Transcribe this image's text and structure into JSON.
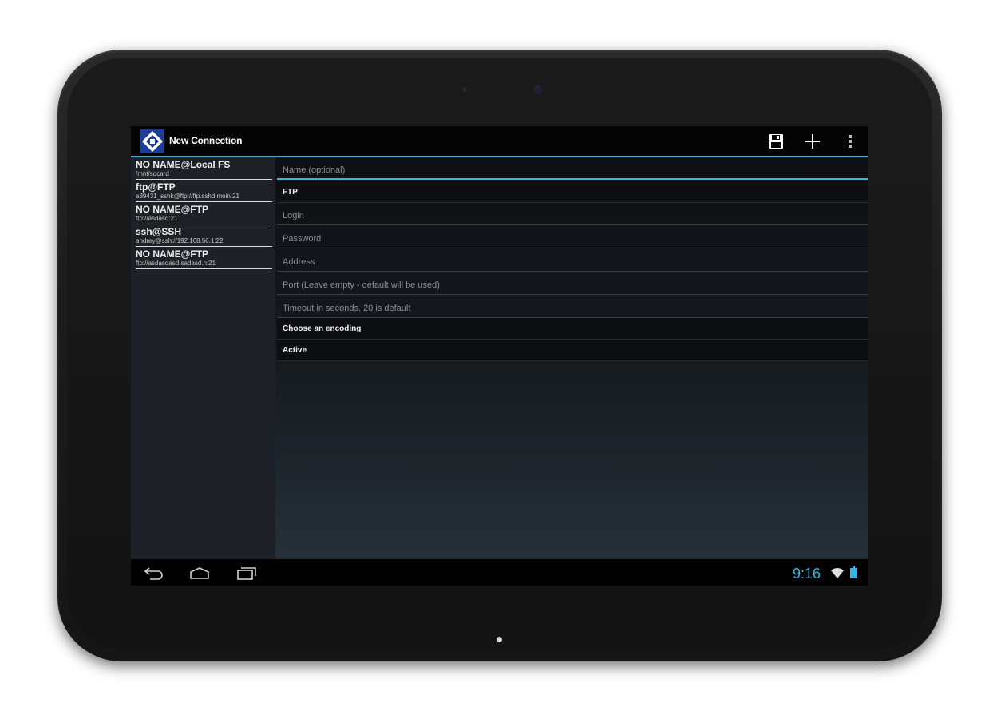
{
  "app": {
    "title": "New Connection",
    "accent_color": "#33b5e5",
    "logo_icon": "app-logo-diamond-icon"
  },
  "toolbar": {
    "save_icon": "save-disk-icon",
    "add_icon": "plus-icon",
    "overflow_icon": "overflow-menu-icon"
  },
  "connections": [
    {
      "name": "NO NAME@Local FS",
      "path": "/mnt/sdcard"
    },
    {
      "name": "ftp@FTP",
      "path": "a39431_sshk@ftp://ftp.sshd.moin:21"
    },
    {
      "name": "NO NAME@FTP",
      "path": "ftp://asdasd:21"
    },
    {
      "name": "ssh@SSH",
      "path": "andrey@ssh://192.168.56.1:22"
    },
    {
      "name": "NO NAME@FTP",
      "path": "ftp://asdasdasd.sadasd.n:21"
    }
  ],
  "form": {
    "name_placeholder": "Name (optional)",
    "protocol_value": "FTP",
    "login_placeholder": "Login",
    "password_placeholder": "Password",
    "address_placeholder": "Address",
    "port_placeholder": "Port (Leave empty - default will be used)",
    "timeout_placeholder": "Timeout in seconds. 20 is default",
    "encoding_value": "Choose an encoding",
    "mode_value": "Active"
  },
  "system_bar": {
    "time": "9:16",
    "back_icon": "back-icon",
    "home_icon": "home-icon",
    "recents_icon": "recents-icon",
    "wifi_icon": "wifi-icon",
    "battery_icon": "battery-icon"
  }
}
